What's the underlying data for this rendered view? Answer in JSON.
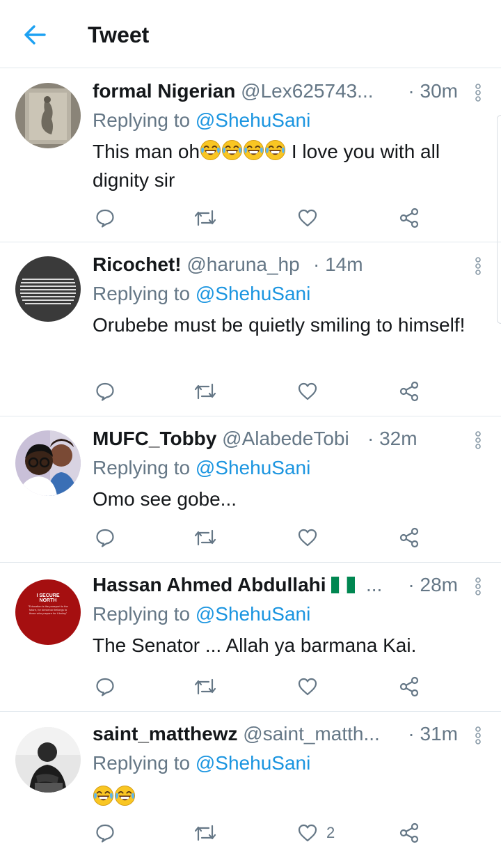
{
  "header": {
    "title": "Tweet"
  },
  "reply_prefix": "Replying to ",
  "tweets": [
    {
      "name": "formal Nigerian",
      "handle": "@Lex625743...",
      "time": "· 30m",
      "reply_to": "@ShehuSani",
      "text_before": "This man oh",
      "text_after": " I love you with all dignity sir",
      "emoji": "face-with-tears-of-joy x4",
      "likes": ""
    },
    {
      "name": "Ricochet!",
      "handle": "@haruna_hp",
      "time": "· 14m",
      "reply_to": "@ShehuSani",
      "text": "Orubebe must be quietly smiling to himself!",
      "likes": ""
    },
    {
      "name": "MUFC_Tobby",
      "handle": "@AlabedeTobi",
      "time": "· 32m",
      "reply_to": "@ShehuSani",
      "text": "Omo see gobe...",
      "likes": ""
    },
    {
      "name": "Hassan Ahmed Abdullahi",
      "handle": "...",
      "time": "· 28m",
      "reply_to": "@ShehuSani",
      "text": "The Senator ... Allah ya barmana Kai.",
      "avatar_text": {
        "title": "I SECURE NORTH",
        "quote": "\"Education is the passport to the future, for tomorrow belongs to those who prepare for it today\""
      },
      "likes": ""
    },
    {
      "name": "saint_matthewz",
      "handle": "@saint_matth...",
      "time": "· 31m",
      "reply_to": "@ShehuSani",
      "text": "",
      "emoji": "face-with-tears-of-joy x2",
      "likes": "2"
    }
  ],
  "colors": {
    "accent": "#1da1f2",
    "mention": "#1b95e0",
    "secondary_text": "#657786",
    "divider": "#e1e8ed"
  }
}
